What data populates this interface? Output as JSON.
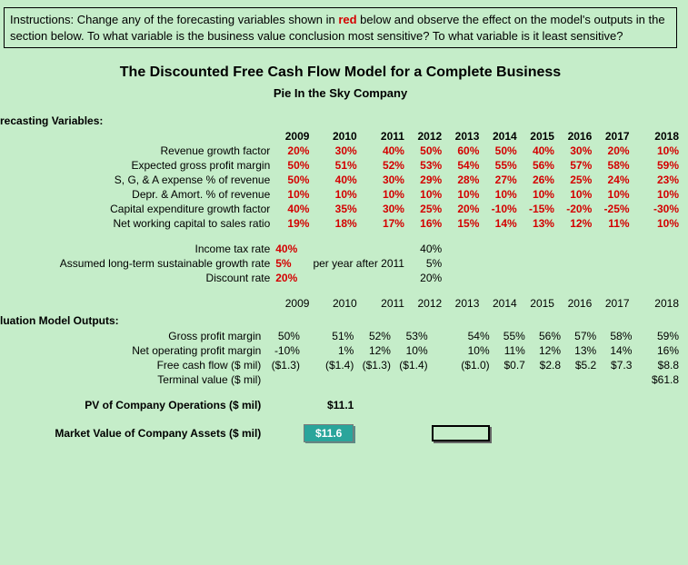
{
  "instructions_p1": "Instructions:  Change  any of the forecasting variables  shown in ",
  "instructions_red": "red",
  "instructions_p2": " below and observe  the effect on the model's outputs in the section below.   To what variable  is the business value  conclusion most sensitive?   To what variable  is it least sensitive?",
  "title": "The Discounted Free Cash Flow Model for a Complete Business",
  "subtitle": "Pie In the Sky Company",
  "forecast_header": "recasting Variables:",
  "years": [
    "2009",
    "2010",
    "2011",
    "2012",
    "2013",
    "2014",
    "2015",
    "2016",
    "2017",
    "2018"
  ],
  "rows_fore": [
    {
      "label": "Revenue growth factor",
      "vals": [
        "20%",
        "30%",
        "40%",
        "50%",
        "60%",
        "50%",
        "40%",
        "30%",
        "20%",
        "10%"
      ]
    },
    {
      "label": "Expected gross profit margin",
      "vals": [
        "50%",
        "51%",
        "52%",
        "53%",
        "54%",
        "55%",
        "56%",
        "57%",
        "58%",
        "59%"
      ]
    },
    {
      "label": "S, G, & A expense % of revenue",
      "vals": [
        "50%",
        "40%",
        "30%",
        "29%",
        "28%",
        "27%",
        "26%",
        "25%",
        "24%",
        "23%"
      ]
    },
    {
      "label": "Depr. & Amort. % of revenue",
      "vals": [
        "10%",
        "10%",
        "10%",
        "10%",
        "10%",
        "10%",
        "10%",
        "10%",
        "10%",
        "10%"
      ]
    },
    {
      "label": "Capital expenditure growth factor",
      "vals": [
        "40%",
        "35%",
        "30%",
        "25%",
        "20%",
        "-10%",
        "-15%",
        "-20%",
        "-25%",
        "-30%"
      ]
    },
    {
      "label": "Net working capital to sales ratio",
      "vals": [
        "19%",
        "18%",
        "17%",
        "16%",
        "15%",
        "14%",
        "13%",
        "12%",
        "11%",
        "10%"
      ]
    }
  ],
  "assump": [
    {
      "label": "Income tax rate",
      "v": "40%",
      "note": "",
      "b": "40%"
    },
    {
      "label": "Assumed long-term sustainable growth rate",
      "v": "5%",
      "note": "per year after 2011",
      "b": "5%"
    },
    {
      "label": "Discount rate",
      "v": "20%",
      "note": "",
      "b": "20%"
    }
  ],
  "outputs_header": "luation Model Outputs:",
  "rows_out": [
    {
      "label": "Gross profit margin",
      "vals": [
        "50%",
        "51%",
        "52%",
        "53%",
        "54%",
        "55%",
        "56%",
        "57%",
        "58%",
        "59%"
      ]
    },
    {
      "label": "Net operating profit margin",
      "vals": [
        "-10%",
        "1%",
        "12%",
        "10%",
        "10%",
        "11%",
        "12%",
        "13%",
        "14%",
        "16%"
      ]
    },
    {
      "label": "Free cash flow ($ mil)",
      "vals": [
        "($1.3)",
        "($1.4)",
        "($1.3)",
        "($1.4)",
        "($1.0)",
        "$0.7",
        "$2.8",
        "$5.2",
        "$7.3",
        "$8.8"
      ]
    },
    {
      "label": "Terminal value ($ mil)",
      "vals": [
        "",
        "",
        "",
        "",
        "",
        "",
        "",
        "",
        "",
        "$61.8"
      ]
    }
  ],
  "pv_label": "PV of Company Operations ($ mil)",
  "pv_value": "$11.1",
  "mv_label": "Market Value of Company Assets ($ mil)",
  "mv_value": "$11.6"
}
